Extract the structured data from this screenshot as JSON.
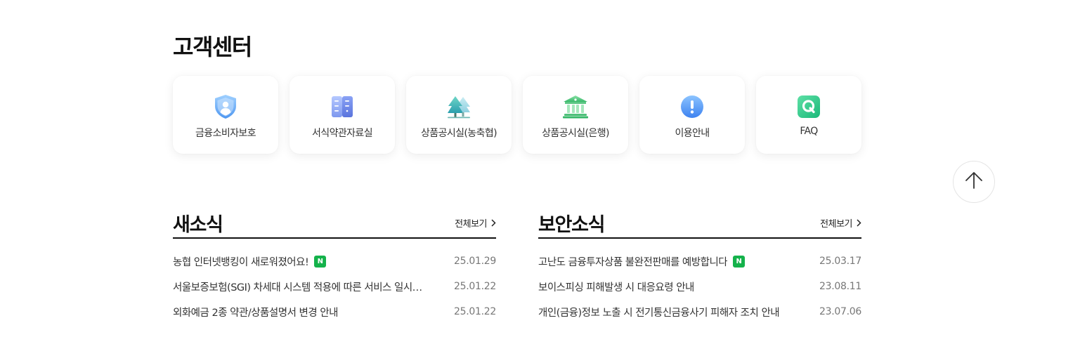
{
  "customer_center": {
    "title": "고객센터",
    "cards": [
      {
        "label": "금융소비자보호",
        "icon": "shield-user-icon"
      },
      {
        "label": "서식약관자료실",
        "icon": "file-cabinet-icon"
      },
      {
        "label": "상품공시실(농축협)",
        "icon": "trees-icon"
      },
      {
        "label": "상품공시실(은행)",
        "icon": "bank-building-icon"
      },
      {
        "label": "이용안내",
        "icon": "exclamation-icon"
      },
      {
        "label": "FAQ",
        "icon": "faq-q-icon"
      }
    ]
  },
  "news": {
    "title": "새소식",
    "more_label": "전체보기",
    "items": [
      {
        "text": "농협 인터넷뱅킹이 새로워졌어요!",
        "is_new": true,
        "new_badge": "N",
        "date": "25.01.29"
      },
      {
        "text": "서울보증보험(SGI) 차세대 시스템 적용에 따른 서비스 일시 중단 안내",
        "is_new": false,
        "new_badge": "",
        "date": "25.01.22"
      },
      {
        "text": "외화예금 2종 약관/상품설명서 변경 안내",
        "is_new": false,
        "new_badge": "",
        "date": "25.01.22"
      }
    ]
  },
  "security": {
    "title": "보안소식",
    "more_label": "전체보기",
    "items": [
      {
        "text": "고난도 금융투자상품 불완전판매를 예방합니다",
        "is_new": true,
        "new_badge": "N",
        "date": "25.03.17"
      },
      {
        "text": "보이스피싱 피해발생 시 대응요령 안내",
        "is_new": false,
        "new_badge": "",
        "date": "23.08.11"
      },
      {
        "text": "개인(금융)정보 노출 시 전기통신금융사기 피해자 조치 안내",
        "is_new": false,
        "new_badge": "",
        "date": "23.07.06"
      }
    ]
  },
  "top_button": {
    "icon": "arrow-up-icon"
  },
  "colors": {
    "accent_green": "#15b24b",
    "text": "#333333",
    "date": "#777777"
  }
}
